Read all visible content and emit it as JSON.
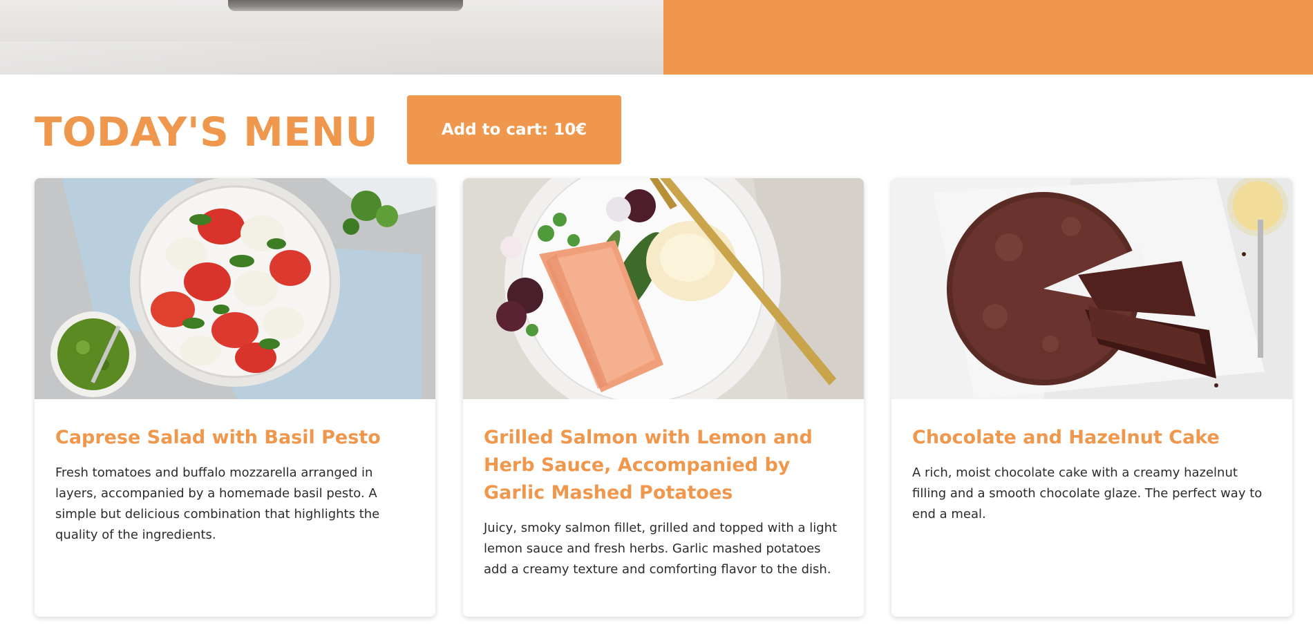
{
  "colors": {
    "accent": "#ef974d",
    "text": "#2b2b2b",
    "background": "#ffffff"
  },
  "header": {
    "title": "TODAY'S MENU",
    "cart_button_label": "Add to cart: 10€"
  },
  "dishes": [
    {
      "title": "Caprese Salad with Basil Pesto",
      "description": "Fresh tomatoes and buffalo mozzarella arranged in layers, accompanied by a homemade basil pesto. A simple but delicious combination that highlights the quality of the ingredients."
    },
    {
      "title": "Grilled Salmon with Lemon and Herb Sauce, Accompanied by Garlic Mashed Potatoes",
      "description": "Juicy, smoky salmon fillet, grilled and topped with a light lemon sauce and fresh herbs. Garlic mashed potatoes add a creamy texture and comforting flavor to the dish."
    },
    {
      "title": "Chocolate and Hazelnut Cake",
      "description": "A rich, moist chocolate cake with a creamy hazelnut filling and a smooth chocolate glaze. The perfect way to end a meal."
    }
  ]
}
